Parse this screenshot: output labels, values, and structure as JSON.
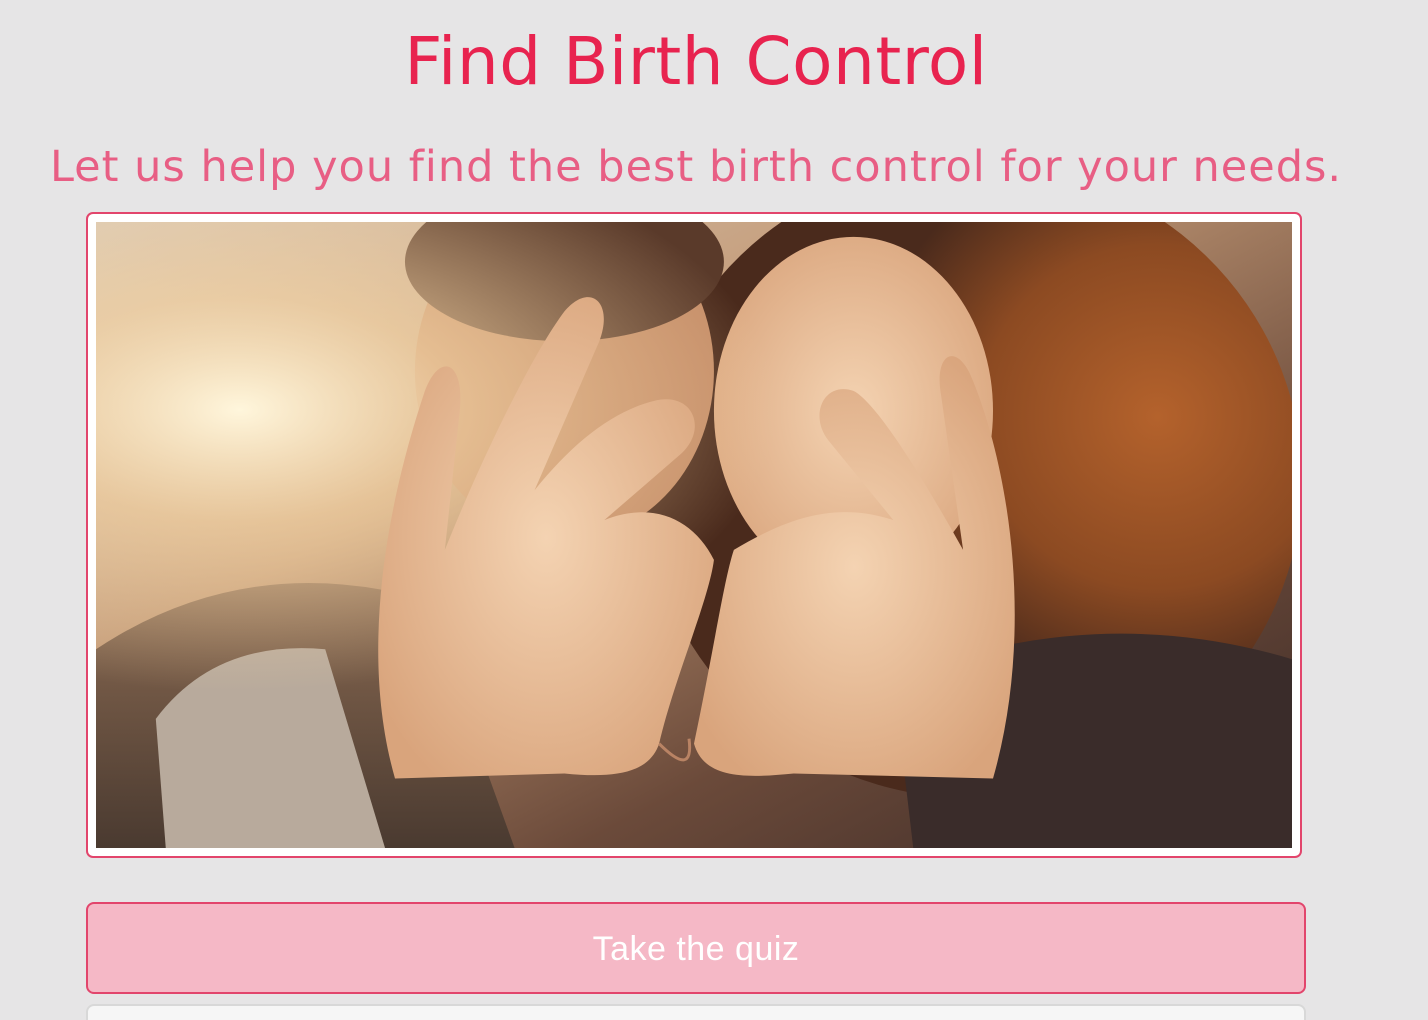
{
  "header": {
    "title": "Find Birth Control",
    "subtitle": "Let us help you find the best birth control for your needs."
  },
  "hero_image": {
    "alt": "Couple making a heart shape with their hands"
  },
  "actions": {
    "quiz_label": "Take the quiz"
  },
  "colors": {
    "accent": "#e8234f",
    "subtitle": "#e85e84",
    "button_fill": "#f5b8c6",
    "border": "#e2456c",
    "background": "#e6e5e6"
  }
}
